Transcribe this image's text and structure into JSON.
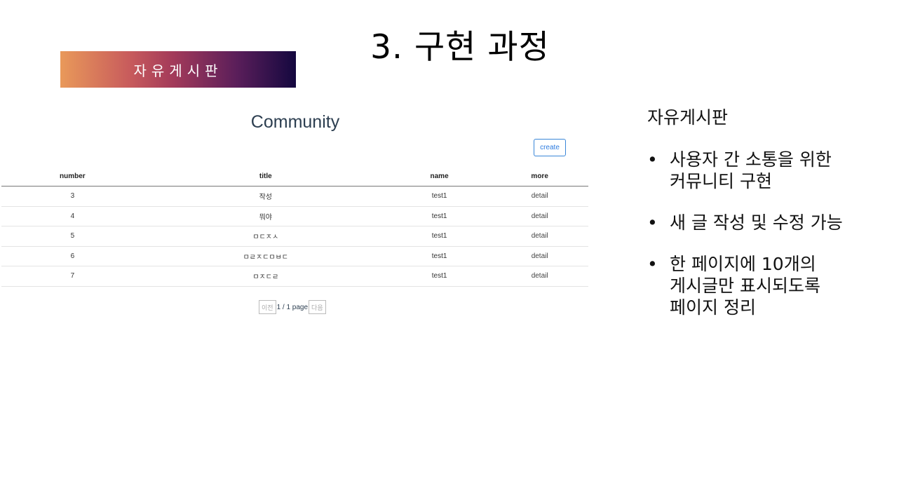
{
  "slide": {
    "title": "3. 구현 과정",
    "banner": "자유게시판"
  },
  "app": {
    "title": "Community",
    "create_label": "create",
    "columns": [
      "number",
      "title",
      "name",
      "more"
    ],
    "rows": [
      {
        "number": "3",
        "title": "작성",
        "name": "test1",
        "more": "detail"
      },
      {
        "number": "4",
        "title": "뭐야",
        "name": "test1",
        "more": "detail"
      },
      {
        "number": "5",
        "title": "ㅁㄷㅈㅅ",
        "name": "test1",
        "more": "detail"
      },
      {
        "number": "6",
        "title": "ㅁㄹㅈㄷㅁㅂㄷ",
        "name": "test1",
        "more": "detail"
      },
      {
        "number": "7",
        "title": "ㅁㅈㄷㄹ",
        "name": "test1",
        "more": "detail"
      }
    ],
    "pagination": {
      "prev_label": "이전",
      "info": "1 / 1 page",
      "next_label": "다음"
    }
  },
  "side": {
    "heading": "자유게시판",
    "bullet_glyph": "•",
    "bullets": [
      "사용자 간 소통을 위한\n커뮤니티 구현",
      "새 글 작성 및 수정 가능",
      "한 페이지에 10개의\n게시글만 표시되도록\n페이지 정리"
    ]
  }
}
